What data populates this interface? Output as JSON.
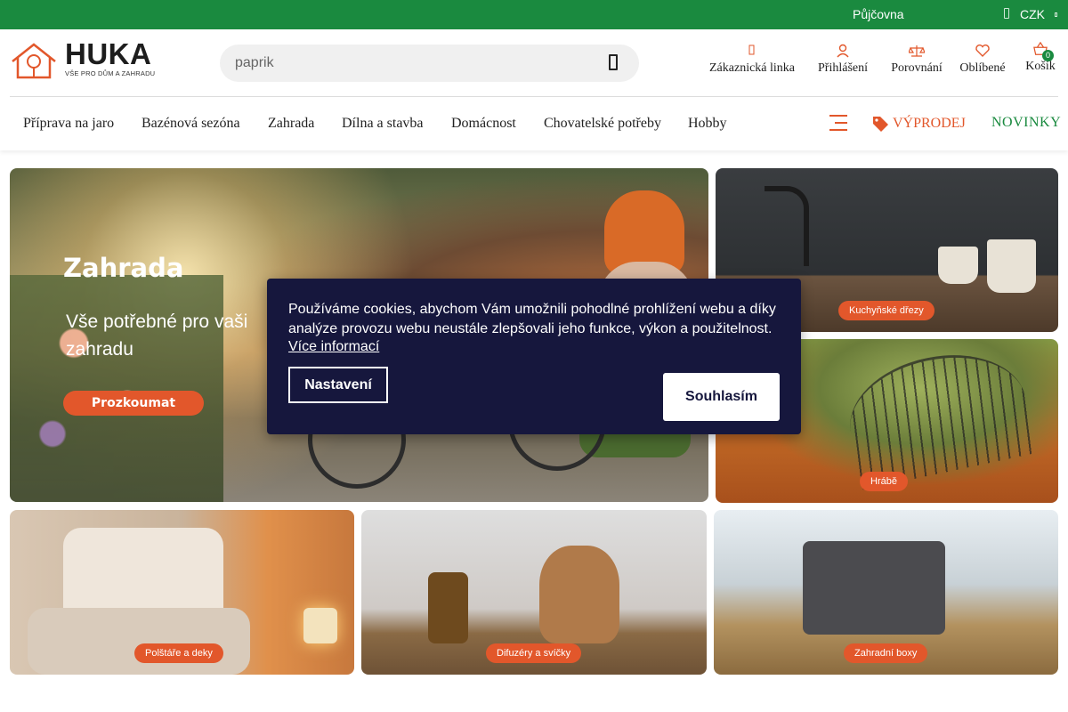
{
  "topbar": {
    "rental": "Půjčovna",
    "currency": "CZK"
  },
  "logo": {
    "brand": "HUKA",
    "tagline": "VŠE PRO DŮM A ZAHRADU"
  },
  "search": {
    "placeholder": "paprik"
  },
  "header_actions": {
    "support": "Zákaznická linka",
    "login": "Přihlášení",
    "compare": "Porovnání",
    "favorites": "Oblíbené",
    "cart": "Košík",
    "cart_count": "0"
  },
  "nav": {
    "items": [
      "Příprava na jaro",
      "Bazénová sezóna",
      "Zahrada",
      "Dílna a stavba",
      "Domácnost",
      "Chovatelské potřeby",
      "Hobby"
    ],
    "sale": "VÝPRODEJ",
    "new": "NOVINKY"
  },
  "main_banner": {
    "title": "Zahrada",
    "subtitle": "Vše potřebné pro vaši zahradu",
    "button": "Prozkoumat"
  },
  "tiles": {
    "sink": "Kuchyňské dřezy",
    "rake": "Hrábě",
    "pillows": "Polštáře a deky",
    "diffusers": "Difuzéry a svíčky",
    "boxes": "Zahradní boxy"
  },
  "cookie": {
    "message": "Používáme cookies, abychom Vám umožnili pohodlné prohlížení webu a díky analýze provozu webu neustále zlepšovali jeho funkce, výkon a použitelnost.",
    "more": "Více informací",
    "settings": "Nastavení",
    "agree": "Souhlasím"
  },
  "colors": {
    "green": "#1a8a3f",
    "orange": "#e2572b",
    "navy": "#16173d"
  }
}
